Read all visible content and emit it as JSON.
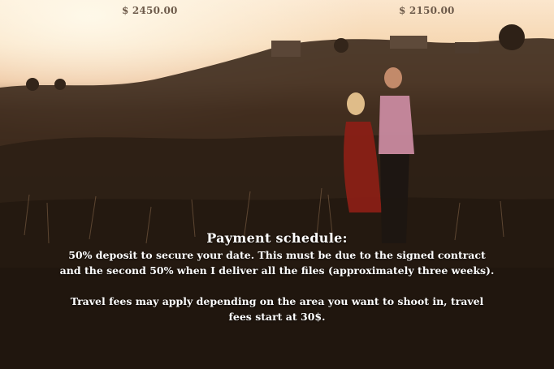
{
  "pricing": {
    "left_price": "$ 2450.00",
    "right_price": "$ 2150.00"
  },
  "payment": {
    "title": "Payment schedule:",
    "body": "50% deposit to secure your date. This must be due to the signed contract and the second 50% when I deliver all the files (approximately three weeks).",
    "travel": "Travel fees may apply depending on the area you want to shoot in, travel fees start at 30$."
  },
  "colors": {
    "price_text": "#6e5b4b",
    "overlay_text": "#ffffff"
  }
}
